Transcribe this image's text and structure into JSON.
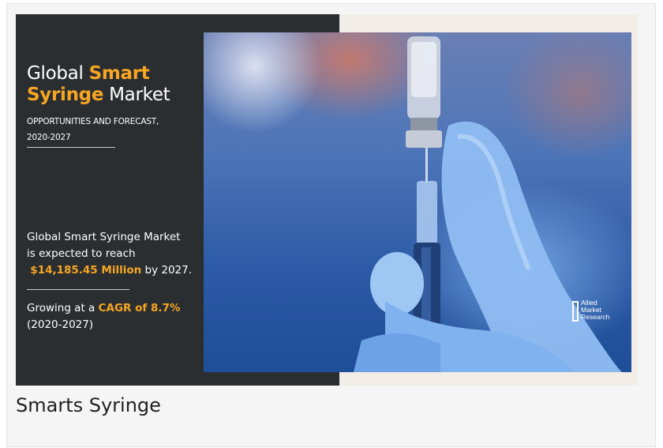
{
  "banner": {
    "title_prefix": "Global ",
    "title_accent_1": "Smart",
    "title_accent_2": "Syringe",
    "title_suffix": " Market",
    "subtitle_line1": "OPPORTUNITIES AND FORECAST,",
    "subtitle_line2": "2020-2027",
    "stat_line1": "Global Smart Syringe Market",
    "stat_line2": "is expected to reach",
    "stat_value": "$14,185.45 Million",
    "stat_suffix": " by 2027.",
    "growth_prefix": "Growing at a ",
    "growth_value": "CAGR of 8.7%",
    "growth_period": "(2020-2027)",
    "logo_line1": "Allied",
    "logo_line2": "Market",
    "logo_line3": "Research",
    "accent_color": "#f6a623",
    "panel_color": "#2b2e31"
  },
  "caption": "Smarts Syringe"
}
